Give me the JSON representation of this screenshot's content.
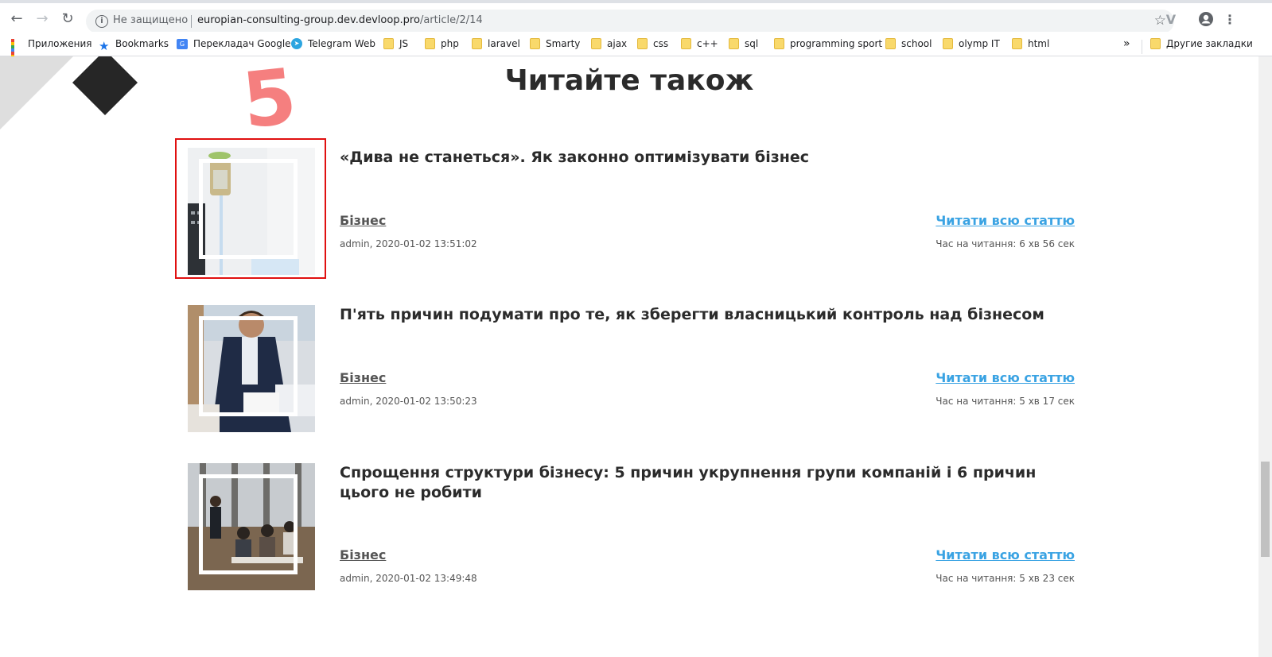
{
  "browser": {
    "url_security": "Не защищено",
    "url_host": "europian-consulting-group.dev.devloop.pro",
    "url_path": "/article/2/14",
    "bookmarks": [
      {
        "label": "Приложения",
        "icon": "apps-grid-icon"
      },
      {
        "label": "Bookmarks",
        "icon": "star-icon"
      },
      {
        "label": "Перекладач Google",
        "icon": "google-translate-icon"
      },
      {
        "label": "Telegram Web",
        "icon": "telegram-icon"
      },
      {
        "label": "JS",
        "icon": "folder-icon"
      },
      {
        "label": "php",
        "icon": "folder-icon"
      },
      {
        "label": "laravel",
        "icon": "folder-icon"
      },
      {
        "label": "Smarty",
        "icon": "folder-icon"
      },
      {
        "label": "ajax",
        "icon": "folder-icon"
      },
      {
        "label": "css",
        "icon": "folder-icon"
      },
      {
        "label": "c++",
        "icon": "folder-icon"
      },
      {
        "label": "sql",
        "icon": "folder-icon"
      },
      {
        "label": "programming sport",
        "icon": "folder-icon"
      },
      {
        "label": "school",
        "icon": "folder-icon"
      },
      {
        "label": "olymp IT",
        "icon": "folder-icon"
      },
      {
        "label": "html",
        "icon": "folder-icon"
      }
    ],
    "overflow_label": "»",
    "other_bookmarks": "Другие закладки"
  },
  "page": {
    "section_title": "Читайте також",
    "annotation_number": "5",
    "accent_link_color": "#3aa3e3",
    "articles": [
      {
        "title": "«Дива не станеться». Як законно оптимізувати бізнес",
        "category": "Бізнес",
        "meta": "admin, 2020-01-02 13:51:02",
        "read_more": "Читати всю статтю",
        "reading_time": "Час на читання: 6 хв 56 сек",
        "highlighted": true
      },
      {
        "title": "П'ять причин подумати про те, як зберегти власницький контроль над бізнесом",
        "category": "Бізнес",
        "meta": "admin, 2020-01-02 13:50:23",
        "read_more": "Читати всю статтю",
        "reading_time": "Час на читання: 5 хв 17 сек",
        "highlighted": false
      },
      {
        "title": "Спрощення структури бізнесу: 5 причин укрупнення групи компаній і 6 причин цього не робити",
        "category": "Бізнес",
        "meta": "admin, 2020-01-02 13:49:48",
        "read_more": "Читати всю статтю",
        "reading_time": "Час на читання: 5 хв 23 сек",
        "highlighted": false
      }
    ]
  }
}
